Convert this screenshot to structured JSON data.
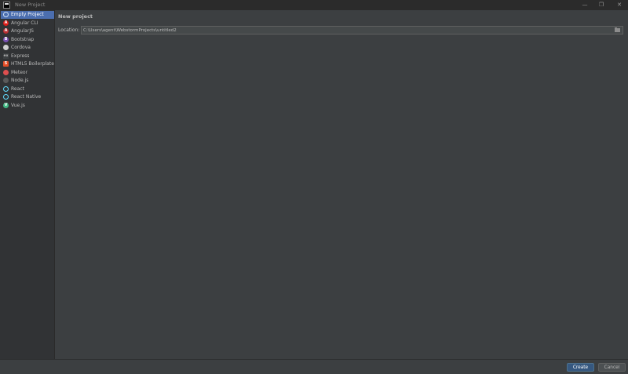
{
  "window": {
    "title": "New Project",
    "controls": {
      "minimize": "—",
      "maximize": "❐",
      "close": "✕"
    }
  },
  "sidebar": {
    "items": [
      {
        "label": "Empty Project",
        "icon": "empty-project-icon",
        "color": "#6a9fd4",
        "glyph": "",
        "selected": true
      },
      {
        "label": "Angular CLI",
        "icon": "angular-icon",
        "color": "#dd1b16",
        "glyph": "A"
      },
      {
        "label": "AngularJS",
        "icon": "angularjs-icon",
        "color": "#b52e31",
        "glyph": "A"
      },
      {
        "label": "Bootstrap",
        "icon": "bootstrap-icon",
        "color": "#7952b3",
        "glyph": "B"
      },
      {
        "label": "Cordova",
        "icon": "cordova-icon",
        "color": "#d0d0d0",
        "glyph": ""
      },
      {
        "label": "Express",
        "icon": "express-icon",
        "color": "#3c3f41",
        "glyph": "ex"
      },
      {
        "label": "HTML5 Boilerplate",
        "icon": "html5-icon",
        "color": "#e44d26",
        "glyph": "5"
      },
      {
        "label": "Meteor",
        "icon": "meteor-icon",
        "color": "#de4f4f",
        "glyph": ""
      },
      {
        "label": "Node.js",
        "icon": "nodejs-icon",
        "color": "#5a5a5a",
        "glyph": ""
      },
      {
        "label": "React",
        "icon": "react-icon",
        "color": "#61dafb",
        "glyph": ""
      },
      {
        "label": "React Native",
        "icon": "react-native-icon",
        "color": "#61dafb",
        "glyph": ""
      },
      {
        "label": "Vue.js",
        "icon": "vue-icon",
        "color": "#41b883",
        "glyph": "V"
      }
    ]
  },
  "main": {
    "heading": "New project",
    "location_label": "Location:",
    "location_value": "C:\\Users\\agent\\WebstormProjects\\untitled2"
  },
  "footer": {
    "create_label": "Create",
    "cancel_label": "Cancel"
  },
  "colors": {
    "background": "#3c3f41",
    "sidebar": "#313335",
    "selection": "#4b6eaf",
    "primary_button": "#365880"
  }
}
